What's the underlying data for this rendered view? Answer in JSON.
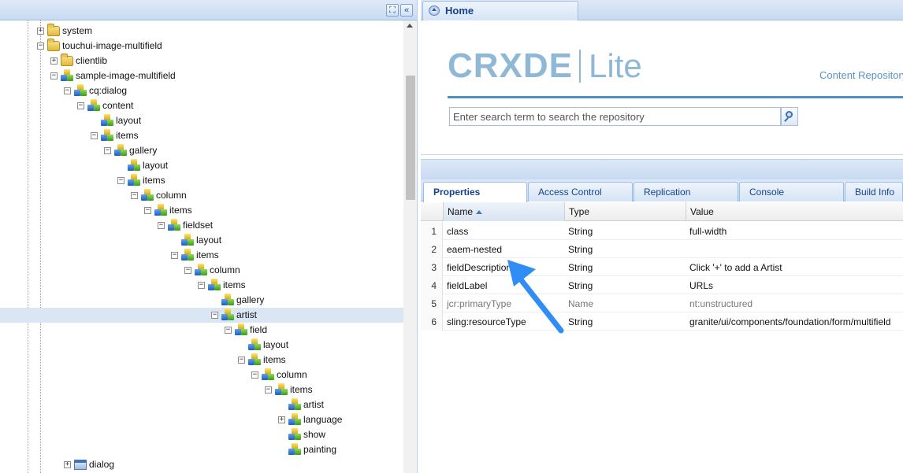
{
  "tree": {
    "header_buttons": [
      {
        "icon": "binoculars-icon",
        "glyph": "⛶"
      },
      {
        "icon": "collapse-left-icon",
        "glyph": "«"
      }
    ],
    "nodes": [
      {
        "label": "system",
        "depth": 0,
        "icon": "folder",
        "toggle": "+"
      },
      {
        "label": "touchui-image-multifield",
        "depth": 0,
        "icon": "folder",
        "toggle": "-"
      },
      {
        "label": "clientlib",
        "depth": 1,
        "icon": "folder",
        "toggle": "+"
      },
      {
        "label": "sample-image-multifield",
        "depth": 1,
        "icon": "node",
        "toggle": "-"
      },
      {
        "label": "cq:dialog",
        "depth": 2,
        "icon": "node",
        "toggle": "-"
      },
      {
        "label": "content",
        "depth": 3,
        "icon": "node",
        "toggle": "-"
      },
      {
        "label": "layout",
        "depth": 4,
        "icon": "node",
        "toggle": ""
      },
      {
        "label": "items",
        "depth": 4,
        "icon": "node",
        "toggle": "-"
      },
      {
        "label": "gallery",
        "depth": 5,
        "icon": "node",
        "toggle": "-"
      },
      {
        "label": "layout",
        "depth": 6,
        "icon": "node",
        "toggle": ""
      },
      {
        "label": "items",
        "depth": 6,
        "icon": "node",
        "toggle": "-"
      },
      {
        "label": "column",
        "depth": 7,
        "icon": "node",
        "toggle": "-"
      },
      {
        "label": "items",
        "depth": 8,
        "icon": "node",
        "toggle": "-"
      },
      {
        "label": "fieldset",
        "depth": 9,
        "icon": "node",
        "toggle": "-"
      },
      {
        "label": "layout",
        "depth": 10,
        "icon": "node",
        "toggle": ""
      },
      {
        "label": "items",
        "depth": 10,
        "icon": "node",
        "toggle": "-"
      },
      {
        "label": "column",
        "depth": 11,
        "icon": "node",
        "toggle": "-"
      },
      {
        "label": "items",
        "depth": 12,
        "icon": "node",
        "toggle": "-"
      },
      {
        "label": "gallery",
        "depth": 13,
        "icon": "node",
        "toggle": ""
      },
      {
        "label": "artist",
        "depth": 13,
        "icon": "node",
        "toggle": "-",
        "selected": true
      },
      {
        "label": "field",
        "depth": 14,
        "icon": "node",
        "toggle": "-"
      },
      {
        "label": "layout",
        "depth": 15,
        "icon": "node",
        "toggle": ""
      },
      {
        "label": "items",
        "depth": 15,
        "icon": "node",
        "toggle": "-"
      },
      {
        "label": "column",
        "depth": 16,
        "icon": "node",
        "toggle": "-"
      },
      {
        "label": "items",
        "depth": 17,
        "icon": "node",
        "toggle": "-"
      },
      {
        "label": "artist",
        "depth": 18,
        "icon": "node",
        "toggle": ""
      },
      {
        "label": "language",
        "depth": 18,
        "icon": "node",
        "toggle": "+"
      },
      {
        "label": "show",
        "depth": 18,
        "icon": "node",
        "toggle": ""
      },
      {
        "label": "painting",
        "depth": 18,
        "icon": "node",
        "toggle": ""
      },
      {
        "label": "dialog",
        "depth": 2,
        "icon": "dialog",
        "toggle": "+",
        "gap_before": true
      }
    ]
  },
  "home_tab": {
    "label": "Home"
  },
  "home": {
    "logo_left": "CRXDE",
    "logo_right": "Lite",
    "tagline": "Content Repository",
    "search_placeholder": "Enter search term to search the repository"
  },
  "properties": {
    "tabs": [
      "Properties",
      "Access Control",
      "Replication",
      "Console",
      "Build Info"
    ],
    "active_tab": 0,
    "columns": {
      "name": "Name",
      "type": "Type",
      "value": "Value"
    },
    "rows": [
      {
        "num": "1",
        "name": "class",
        "type": "String",
        "value": "full-width"
      },
      {
        "num": "2",
        "name": "eaem-nested",
        "type": "String",
        "value": ""
      },
      {
        "num": "3",
        "name": "fieldDescription",
        "type": "String",
        "value": "Click '+' to add a Artist"
      },
      {
        "num": "4",
        "name": "fieldLabel",
        "type": "String",
        "value": "URLs"
      },
      {
        "num": "5",
        "name": "jcr:primaryType",
        "type": "Name",
        "value": "nt:unstructured",
        "muted": true
      },
      {
        "num": "6",
        "name": "sling:resourceType",
        "type": "String",
        "value": "granite/ui/components/foundation/form/multifield"
      }
    ]
  },
  "colors": {
    "accent_blue": "#15428b",
    "logo_blue": "#8fb7d6",
    "annotation_arrow": "#2f8df5",
    "selection": "#dbe6f4"
  }
}
